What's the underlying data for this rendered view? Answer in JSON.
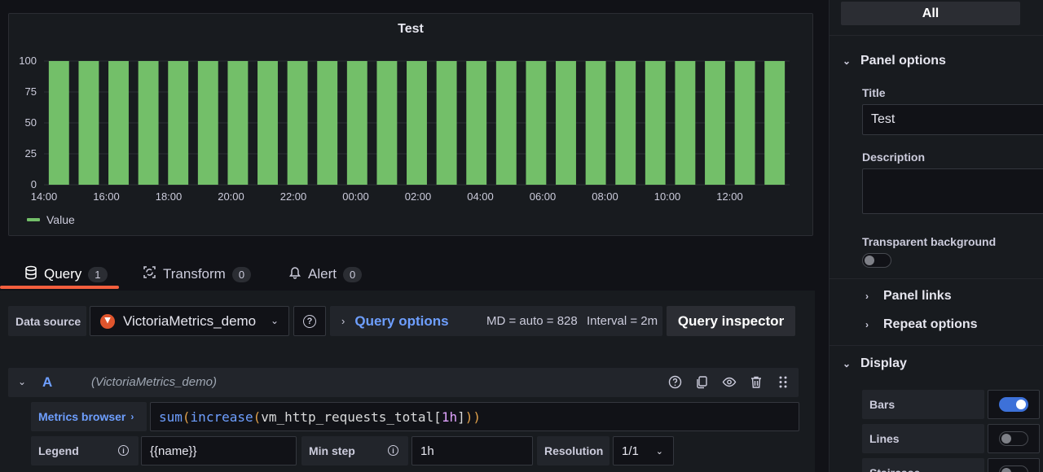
{
  "panel": {
    "title": "Test"
  },
  "chart_data": {
    "type": "bar",
    "title": "Test",
    "x_ticks": [
      "14:00",
      "16:00",
      "18:00",
      "20:00",
      "22:00",
      "00:00",
      "02:00",
      "04:00",
      "06:00",
      "08:00",
      "10:00",
      "12:00"
    ],
    "y_ticks": [
      "100",
      "75",
      "50",
      "25",
      "0"
    ],
    "ylim": [
      0,
      100
    ],
    "bar_count": 24,
    "series": [
      {
        "name": "Value",
        "color": "#73bf69",
        "values": [
          100,
          100,
          100,
          100,
          100,
          100,
          100,
          100,
          100,
          100,
          100,
          100,
          100,
          100,
          100,
          100,
          100,
          100,
          100,
          100,
          100,
          100,
          100,
          100,
          100
        ]
      }
    ],
    "legend": "bottom-left",
    "grid": true
  },
  "tabs": [
    {
      "label": "Query",
      "count": "1",
      "icon": "database-icon"
    },
    {
      "label": "Transform",
      "count": "0",
      "icon": "transform-icon"
    },
    {
      "label": "Alert",
      "count": "0",
      "icon": "bell-icon"
    }
  ],
  "toolbar": {
    "datasource_label": "Data source",
    "datasource_value": "VictoriaMetrics_demo",
    "query_options_label": "Query options",
    "md_text": "MD = auto = 828",
    "interval_text": "Interval = 2m",
    "query_inspector_label": "Query inspector"
  },
  "query_a": {
    "letter": "A",
    "datasource": "(VictoriaMetrics_demo)",
    "metrics_browser_label": "Metrics browser",
    "expr": {
      "fn1": "sum",
      "p1": "(",
      "fn2": "increase",
      "p2": "(",
      "metric": "vm_http_requests_total",
      "lb": "[",
      "dur": "1h",
      "rb": "]",
      "p3": ")",
      "p4": ")"
    },
    "legend_label": "Legend",
    "legend_value": "{{name}}",
    "min_step_label": "Min step",
    "min_step_value": "1h",
    "resolution_label": "Resolution",
    "resolution_value": "1/1"
  },
  "options": {
    "all_label": "All",
    "panel_options_label": "Panel options",
    "title_label": "Title",
    "title_value": "Test",
    "description_label": "Description",
    "description_value": "",
    "transparent_label": "Transparent background",
    "transparent_on": false,
    "panel_links_label": "Panel links",
    "repeat_options_label": "Repeat options",
    "display_label": "Display",
    "bars_label": "Bars",
    "bars_on": true,
    "lines_label": "Lines",
    "lines_on": false,
    "staircase_label": "Staircase",
    "staircase_on": false
  }
}
